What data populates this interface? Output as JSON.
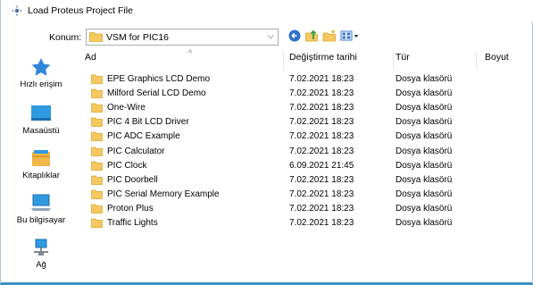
{
  "window": {
    "title": "Load Proteus Project File"
  },
  "location": {
    "label": "Konum:",
    "value": "VSM for PIC16",
    "toolbar_icons": [
      "back-icon",
      "up-folder-icon",
      "new-folder-icon",
      "view-menu-icon"
    ]
  },
  "places": [
    {
      "label": "Hızlı erişim",
      "icon": "star-icon"
    },
    {
      "label": "Masaüstü",
      "icon": "desktop-icon"
    },
    {
      "label": "Kitaplıklar",
      "icon": "libraries-icon"
    },
    {
      "label": "Bu bilgisayar",
      "icon": "computer-icon"
    },
    {
      "label": "Ağ",
      "icon": "network-icon"
    }
  ],
  "columns": {
    "name": "Ad",
    "date": "Değiştirme tarihi",
    "type": "Tür",
    "size": "Boyut"
  },
  "files": [
    {
      "name": "EPE Graphics LCD Demo",
      "date": "7.02.2021 18:23",
      "type": "Dosya klasörü"
    },
    {
      "name": "Milford Serial LCD Demo",
      "date": "7.02.2021 18:23",
      "type": "Dosya klasörü"
    },
    {
      "name": "One-Wire",
      "date": "7.02.2021 18:23",
      "type": "Dosya klasörü"
    },
    {
      "name": "PIC 4 Bit LCD Driver",
      "date": "7.02.2021 18:23",
      "type": "Dosya klasörü"
    },
    {
      "name": "PIC ADC Example",
      "date": "7.02.2021 18:23",
      "type": "Dosya klasörü"
    },
    {
      "name": "PIC Calculator",
      "date": "7.02.2021 18:23",
      "type": "Dosya klasörü"
    },
    {
      "name": "PIC Clock",
      "date": "6.09.2021 21:45",
      "type": "Dosya klasörü"
    },
    {
      "name": "PIC Doorbell",
      "date": "7.02.2021 18:23",
      "type": "Dosya klasörü"
    },
    {
      "name": "PIC Serial Memory Example",
      "date": "7.02.2021 18:23",
      "type": "Dosya klasörü"
    },
    {
      "name": "Proton Plus",
      "date": "7.02.2021 18:23",
      "type": "Dosya klasörü"
    },
    {
      "name": "Traffic Lights",
      "date": "7.02.2021 18:23",
      "type": "Dosya klasörü"
    }
  ],
  "colors": {
    "folder": "#f5c860",
    "accent": "#3a94c8",
    "selection_border": "#adadad"
  }
}
